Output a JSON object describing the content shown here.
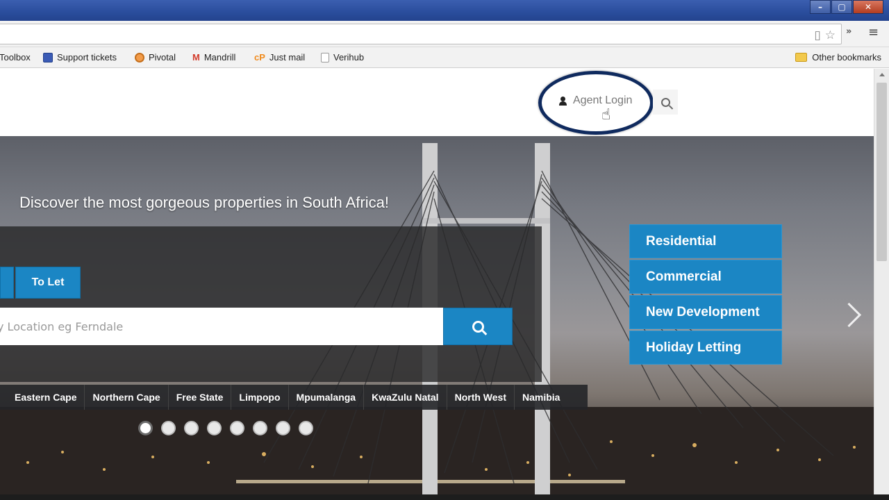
{
  "browser": {
    "window_buttons": [
      "–",
      "▢",
      "✕"
    ],
    "bookmarks": [
      {
        "label": "Toolbox",
        "icon": "toolbox-icon"
      },
      {
        "label": "Support tickets",
        "icon": "ticket-icon"
      },
      {
        "label": "Pivotal",
        "icon": "pivotal-icon"
      },
      {
        "label": "Mandrill",
        "icon": "gmail-icon"
      },
      {
        "label": "Just mail",
        "icon": "cpanel-icon"
      },
      {
        "label": "Verihub",
        "icon": "page-icon"
      }
    ],
    "other_bookmarks": "Other bookmarks"
  },
  "header": {
    "agent_login": "Agent Login"
  },
  "hero": {
    "title": "Discover the most gorgeous properties in South Africa!",
    "tab_to_let": "To Let",
    "location_placeholder": "y Location eg Ferndale",
    "categories": [
      "Residential",
      "Commercial",
      "New Development",
      "Holiday Letting"
    ],
    "provinces": [
      "Eastern Cape",
      "Northern Cape",
      "Free State",
      "Limpopo",
      "Mpumalanga",
      "KwaZulu Natal",
      "North West",
      "Namibia"
    ],
    "slide_count": 8,
    "active_slide": 1
  },
  "colors": {
    "accent": "#1b86c4",
    "annotation": "#0f2a5e"
  }
}
